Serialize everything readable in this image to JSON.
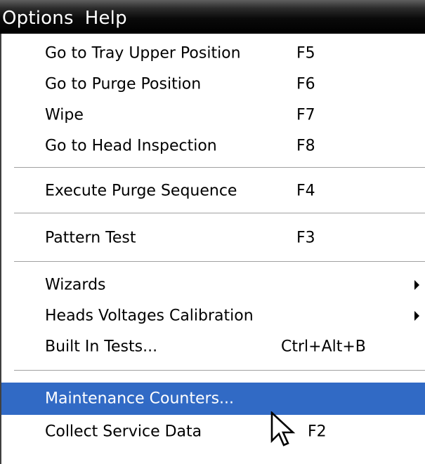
{
  "menubar": {
    "items": [
      "Options",
      "Help"
    ]
  },
  "menu": {
    "items": [
      {
        "label": "Go to Tray Upper Position",
        "shortcut": "F5"
      },
      {
        "label": "Go to Purge Position",
        "shortcut": "F6"
      },
      {
        "label": "Wipe",
        "shortcut": "F7"
      },
      {
        "label": "Go to Head Inspection",
        "shortcut": "F8"
      },
      {
        "label": "Execute Purge Sequence",
        "shortcut": "F4"
      },
      {
        "label": "Pattern Test",
        "shortcut": "F3"
      },
      {
        "label": "Wizards",
        "shortcut": ""
      },
      {
        "label": "Heads Voltages Calibration",
        "shortcut": ""
      },
      {
        "label": "Built In Tests...",
        "shortcut": "Ctrl+Alt+B"
      },
      {
        "label": "Maintenance Counters...",
        "shortcut": ""
      },
      {
        "label": "Collect Service Data",
        "shortcut": "F2"
      }
    ],
    "highlighted_item": "Maintenance Counters..."
  },
  "colors": {
    "menubar_background": "#000000",
    "highlight": "#316ac5",
    "separator": "#a0a0a0"
  },
  "icons": {
    "submenu_indicator": "submenu-arrow-icon",
    "cursor": "mouse-pointer-icon"
  }
}
